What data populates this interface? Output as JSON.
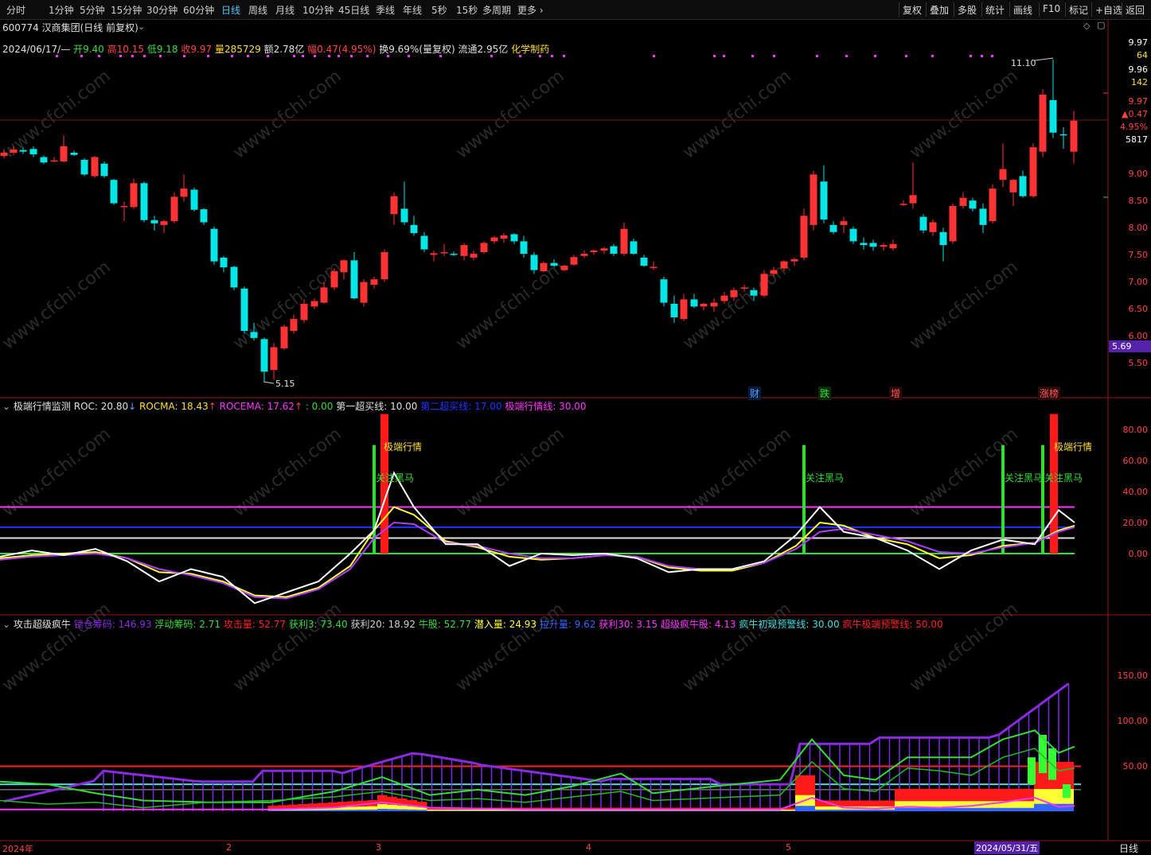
{
  "toolbar": {
    "periods": [
      "分时",
      "1分钟",
      "5分钟",
      "15分钟",
      "30分钟",
      "60分钟",
      "日线",
      "周线",
      "月线",
      "10分钟",
      "45日线",
      "季线",
      "年线",
      "5秒",
      "15秒",
      "多周期",
      "更多 ›"
    ],
    "active_period": "日线",
    "right_buttons": [
      "复权",
      "叠加",
      "多股",
      "统计",
      "画线",
      "F10",
      "标记",
      "+自选",
      "返回"
    ]
  },
  "header": {
    "code_name": "600774 汉商集团(日线 前复权)",
    "date": "2024/06/17/—",
    "open_label": "开",
    "open": "9.40",
    "high_label": "高",
    "high": "10.15",
    "low_label": "低",
    "low": "9.18",
    "close_label": "收",
    "close": "9.97",
    "vol_label": "量",
    "vol": "285729",
    "amount": "额2.78亿",
    "change_label": "幅",
    "change": "0.47(4.95%)",
    "turnover": "换9.69%(量复权)",
    "float_cap": "流通2.95亿",
    "industry": "化学制药"
  },
  "price_axis": {
    "ticks": [
      "9.00",
      "8.50",
      "8.00",
      "7.50",
      "7.00",
      "6.50",
      "6.00",
      "5.50"
    ],
    "readouts": [
      "9.97",
      "64",
      "9.96",
      "142",
      "9.97",
      "▲0.47",
      "4.95%",
      "5817"
    ],
    "cursor_tag": "5.69"
  },
  "annotations": {
    "high_mark": "11.10",
    "low_mark": "5.15",
    "badges": [
      "财",
      "跌",
      "增",
      "涨",
      "榜"
    ]
  },
  "panel2": {
    "title": "极端行情监测",
    "roc": "ROC: 20.80",
    "rocma": "ROCMA: 18.43",
    "rocema": "ROCEMA: 17.62",
    "zero": ": 0.00",
    "buy1": "第一超买线: 10.00",
    "buy2": "第二超买线: 17.00",
    "extreme": "极端行情线: 30.00",
    "ticks": [
      "80.00",
      "60.00",
      "40.00",
      "20.00",
      "0.00"
    ],
    "label_extreme": "极端行情",
    "label_watch": "关注黑马"
  },
  "panel3": {
    "title": "攻击超级疯牛",
    "items": [
      {
        "t": "锁仓筹码: 146.93",
        "c": "#8a2be2"
      },
      {
        "t": "浮动筹码: 2.71",
        "c": "#33dd33"
      },
      {
        "t": "攻击量: 52.77",
        "c": "#ff2222"
      },
      {
        "t": "获利3: 73.40",
        "c": "#33dd33"
      },
      {
        "t": "获利20: 18.92",
        "c": "#d0d0d0"
      },
      {
        "t": "牛股: 52.77",
        "c": "#33dd33"
      },
      {
        "t": "潜入量: 24.93",
        "c": "#ffff33"
      },
      {
        "t": "拉升量: 9.62",
        "c": "#3366ff"
      },
      {
        "t": "获利30: 3.15",
        "c": "#ff33ff"
      },
      {
        "t": "超级疯牛股: 4.13",
        "c": "#ff33ff"
      },
      {
        "t": "疯牛初现预警线: 30.00",
        "c": "#44dddd"
      },
      {
        "t": "疯牛极端预警线: 50.00",
        "c": "#ff2222"
      }
    ],
    "ticks": [
      "150.00",
      "100.00",
      "50.00"
    ]
  },
  "xaxis": {
    "labels": [
      "2024年",
      "2",
      "3",
      "4",
      "5"
    ],
    "cursor_date": "2024/05/31/五",
    "period": "日线"
  },
  "colors": {
    "up": "#ff3333",
    "down": "#00e5e5",
    "bg": "#000000"
  },
  "watermark": "www.cfchi.com"
}
